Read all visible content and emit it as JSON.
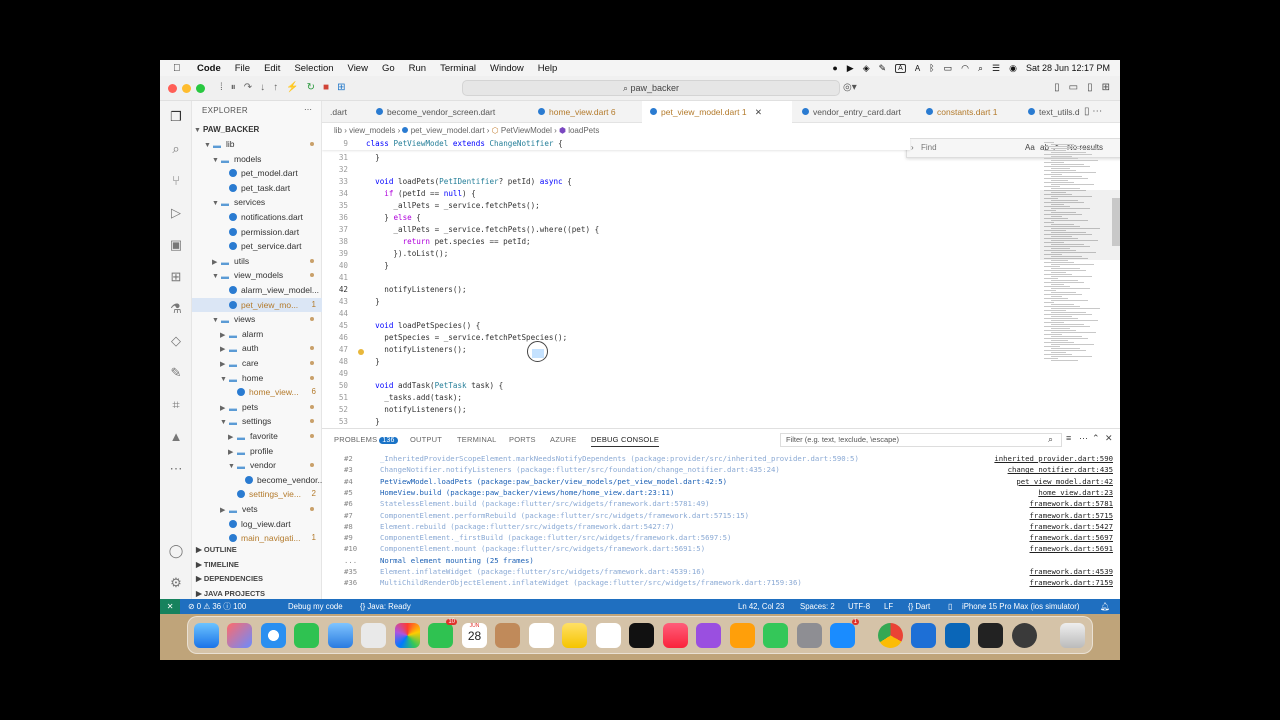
{
  "menubar": {
    "app": "Code",
    "items": [
      "File",
      "Edit",
      "Selection",
      "View",
      "Go",
      "Run",
      "Terminal",
      "Window",
      "Help"
    ],
    "input_badge": "A",
    "datetime": "Sat 28 Jun  12:17 PM"
  },
  "titlebar": {
    "search": "paw_backer"
  },
  "explorer": {
    "header": "EXPLORER",
    "root": "PAW_BACKER",
    "rows": [
      {
        "label": "lib",
        "type": "folder",
        "depth": 1,
        "open": true,
        "dot": true
      },
      {
        "label": "models",
        "type": "folder",
        "depth": 2,
        "open": true
      },
      {
        "label": "pet_model.dart",
        "type": "file",
        "depth": 3
      },
      {
        "label": "pet_task.dart",
        "type": "file",
        "depth": 3
      },
      {
        "label": "services",
        "type": "folder",
        "depth": 2,
        "open": true
      },
      {
        "label": "notifications.dart",
        "type": "file",
        "depth": 3
      },
      {
        "label": "permission.dart",
        "type": "file",
        "depth": 3
      },
      {
        "label": "pet_service.dart",
        "type": "file",
        "depth": 3
      },
      {
        "label": "utils",
        "type": "folder",
        "depth": 2,
        "open": false,
        "dot": true
      },
      {
        "label": "view_models",
        "type": "folder",
        "depth": 2,
        "open": true,
        "dot": true
      },
      {
        "label": "alarm_view_model...",
        "type": "file",
        "depth": 3
      },
      {
        "label": "pet_view_mo...",
        "type": "file",
        "depth": 3,
        "badge": "1",
        "selected": true
      },
      {
        "label": "views",
        "type": "folder",
        "depth": 2,
        "open": true,
        "dot": true
      },
      {
        "label": "alarm",
        "type": "folder",
        "depth": 3,
        "open": false
      },
      {
        "label": "auth",
        "type": "folder",
        "depth": 3,
        "open": false,
        "dot": true
      },
      {
        "label": "care",
        "type": "folder",
        "depth": 3,
        "open": false,
        "dot": true
      },
      {
        "label": "home",
        "type": "folder",
        "depth": 3,
        "open": true,
        "dot": true
      },
      {
        "label": "home_view...",
        "type": "file",
        "depth": 4,
        "badge": "6"
      },
      {
        "label": "pets",
        "type": "folder",
        "depth": 3,
        "open": false,
        "dot": true
      },
      {
        "label": "settings",
        "type": "folder",
        "depth": 3,
        "open": true,
        "dot": true
      },
      {
        "label": "favorite",
        "type": "folder",
        "depth": 4,
        "open": false,
        "dot": true
      },
      {
        "label": "profile",
        "type": "folder",
        "depth": 4,
        "open": false
      },
      {
        "label": "vendor",
        "type": "folder",
        "depth": 4,
        "open": true,
        "dot": true
      },
      {
        "label": "become_vendor...",
        "type": "file",
        "depth": 5
      },
      {
        "label": "settings_vie...",
        "type": "file",
        "depth": 4,
        "badge": "2"
      },
      {
        "label": "vets",
        "type": "folder",
        "depth": 3,
        "open": false,
        "dot": true
      },
      {
        "label": "log_view.dart",
        "type": "file",
        "depth": 3
      },
      {
        "label": "main_navigati...",
        "type": "file",
        "depth": 3,
        "badge": "1"
      }
    ],
    "sections": [
      "OUTLINE",
      "TIMELINE",
      "DEPENDENCIES",
      "JAVA PROJECTS"
    ]
  },
  "tabs": [
    {
      "label": ".dart",
      "active": false
    },
    {
      "label": "become_vendor_screen.dart",
      "active": false
    },
    {
      "label": "home_view.dart",
      "badge": "6",
      "active": false
    },
    {
      "label": "pet_view_model.dart",
      "badge": "1",
      "active": true
    },
    {
      "label": "vendor_entry_card.dart",
      "active": false
    },
    {
      "label": "constants.dart",
      "badge": "1",
      "active": false
    },
    {
      "label": "text_utils.dar",
      "active": false
    }
  ],
  "breadcrumb": [
    "lib",
    "view_models",
    "pet_view_model.dart",
    "PetViewModel",
    "loadPets"
  ],
  "find": {
    "placeholder": "Find",
    "result": "No results",
    "options": "Aa",
    "regex": ".*"
  },
  "code": {
    "sticky": {
      "n": "9",
      "text": "class PetViewModel extends ChangeNotifier {"
    },
    "lines": [
      {
        "n": "31",
        "text": "  }"
      },
      {
        "n": "32",
        "text": ""
      },
      {
        "n": "33",
        "text": "  void loadPets(PetIDentifier? petId) async {"
      },
      {
        "n": "34",
        "text": "    if (petId == null) {"
      },
      {
        "n": "35",
        "text": "      _allPets = _service.fetchPets();"
      },
      {
        "n": "36",
        "text": "    } else {"
      },
      {
        "n": "37",
        "text": "      _allPets = _service.fetchPets().where((pet) {"
      },
      {
        "n": "38",
        "text": "        return pet.species == petId;"
      },
      {
        "n": "39",
        "text": "      }).toList();"
      },
      {
        "n": "40",
        "text": "    }"
      },
      {
        "n": "41",
        "text": ""
      },
      {
        "n": "42",
        "text": "    notifyListeners();"
      },
      {
        "n": "43",
        "text": "  }"
      },
      {
        "n": "44",
        "text": ""
      },
      {
        "n": "45",
        "text": "  void loadPetSpecies() {"
      },
      {
        "n": "46",
        "text": "    petSpecies = _service.fetchPetSpecies();"
      },
      {
        "n": "47",
        "text": "    notifyListeners();"
      },
      {
        "n": "48",
        "text": "  }"
      },
      {
        "n": "49",
        "text": ""
      },
      {
        "n": "50",
        "text": "  void addTask(PetTask task) {"
      },
      {
        "n": "51",
        "text": "    _tasks.add(task);"
      },
      {
        "n": "52",
        "text": "    notifyListeners();"
      },
      {
        "n": "53",
        "text": "  }"
      }
    ]
  },
  "panel": {
    "tabs": [
      {
        "label": "PROBLEMS",
        "badge": "136"
      },
      {
        "label": "OUTPUT"
      },
      {
        "label": "TERMINAL"
      },
      {
        "label": "PORTS"
      },
      {
        "label": "AZURE"
      },
      {
        "label": "DEBUG CONSOLE",
        "active": true
      }
    ],
    "filter_placeholder": "Filter (e.g. text, !exclude, \\escape)",
    "rows": [
      {
        "num": "#2",
        "text": "_InheritedProviderScopeElement.markNeedsNotifyDependents (package:provider/src/inherited_provider.dart:590:5)",
        "src": "inherited_provider.dart:590",
        "style": "dim"
      },
      {
        "num": "#3",
        "text": "ChangeNotifier.notifyListeners (package:flutter/src/foundation/change_notifier.dart:435:24)",
        "src": "change_notifier.dart:435",
        "style": "dim"
      },
      {
        "num": "#4",
        "text": "PetViewModel.loadPets (package:paw_backer/view_models/pet_view_model.dart:42:5)",
        "src": "pet_view_model.dart:42",
        "style": "bold"
      },
      {
        "num": "#5",
        "text": "HomeView.build (package:paw_backer/views/home/home_view.dart:23:11)",
        "src": "home_view.dart:23",
        "style": "bold"
      },
      {
        "num": "#6",
        "text": "StatelessElement.build (package:flutter/src/widgets/framework.dart:5781:49)",
        "src": "framework.dart:5781",
        "style": "dim"
      },
      {
        "num": "#7",
        "text": "ComponentElement.performRebuild (package:flutter/src/widgets/framework.dart:5715:15)",
        "src": "framework.dart:5715",
        "style": "dim"
      },
      {
        "num": "#8",
        "text": "Element.rebuild (package:flutter/src/widgets/framework.dart:5427:7)",
        "src": "framework.dart:5427",
        "style": "dim"
      },
      {
        "num": "#9",
        "text": "ComponentElement._firstBuild (package:flutter/src/widgets/framework.dart:5697:5)",
        "src": "framework.dart:5697",
        "style": "dim"
      },
      {
        "num": "#10",
        "text": "ComponentElement.mount (package:flutter/src/widgets/framework.dart:5691:5)",
        "src": "framework.dart:5691",
        "style": "dim"
      },
      {
        "num": "...",
        "text": "Normal element mounting (25 frames)",
        "src": "",
        "style": "bold"
      },
      {
        "num": "#35",
        "text": "Element.inflateWidget (package:flutter/src/widgets/framework.dart:4539:16)",
        "src": "framework.dart:4539",
        "style": "dim"
      },
      {
        "num": "#36",
        "text": "MultiChildRenderObjectElement.inflateWidget (package:flutter/src/widgets/framework.dart:7159:36)",
        "src": "framework.dart:7159",
        "style": "dim"
      }
    ]
  },
  "statusbar": {
    "problems": "⊘ 0 ⚠ 36 ⓘ 100",
    "debug": "Debug my code",
    "java": "{} Java: Ready",
    "position": "Ln 42, Col 23",
    "spaces": "Spaces: 2",
    "encoding": "UTF-8",
    "eol": "LF",
    "language": "{} Dart",
    "device": "iPhone 15 Pro Max (ios simulator)"
  },
  "dock": {
    "calendar_month": "JUN",
    "calendar_day": "28",
    "facetime_badge": "10",
    "xcode_badge": "1"
  }
}
